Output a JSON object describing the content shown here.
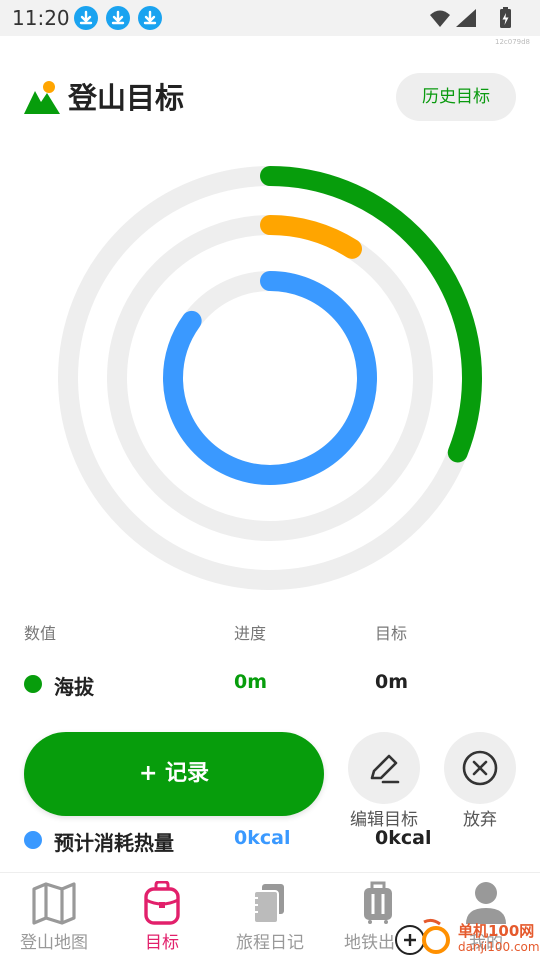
{
  "status_bar": {
    "time": "11:20",
    "tiny_id": "12c079d8",
    "notification_icons": [
      "download-icon",
      "download-icon",
      "download-icon"
    ],
    "system_icons": [
      "wifi-icon",
      "signal-icon",
      "battery-charging-icon"
    ]
  },
  "header": {
    "title": "登山目标",
    "history_button": "历史目标",
    "logo_icon": "mountain-sun-icon"
  },
  "rings": {
    "outer": {
      "color": "#079d0c",
      "progress": 0.31
    },
    "middle": {
      "color": "#ffa500",
      "progress": 0.09
    },
    "inner": {
      "color": "#3a99ff",
      "progress": 0.85
    },
    "track_color": "#eeeeee"
  },
  "table": {
    "headers": [
      "数值",
      "进度",
      "目标"
    ],
    "rows": [
      {
        "color": "#079d0c",
        "name": "海拔",
        "progress": "0m",
        "progress_color": "#079d0c",
        "target": "0m"
      },
      {
        "color": "#3a99ff",
        "name": "预计消耗热量",
        "progress": "0kcal",
        "progress_color": "#3a99ff",
        "target": "0kcal"
      }
    ]
  },
  "actions": {
    "record": "+ 记录",
    "edit": "编辑目标",
    "abandon": "放弃"
  },
  "tabbar": {
    "tabs": [
      {
        "label": "登山地图",
        "icon": "map-icon",
        "active": false
      },
      {
        "label": "目标",
        "icon": "backpack-icon",
        "active": true
      },
      {
        "label": "旅程日记",
        "icon": "notebook-icon",
        "active": false
      },
      {
        "label": "地铁出行",
        "icon": "luggage-icon",
        "active": false
      },
      {
        "label": "我的",
        "icon": "user-icon",
        "active": false
      }
    ]
  },
  "watermark": {
    "text": "单机100网",
    "sub": "danji100.com"
  }
}
